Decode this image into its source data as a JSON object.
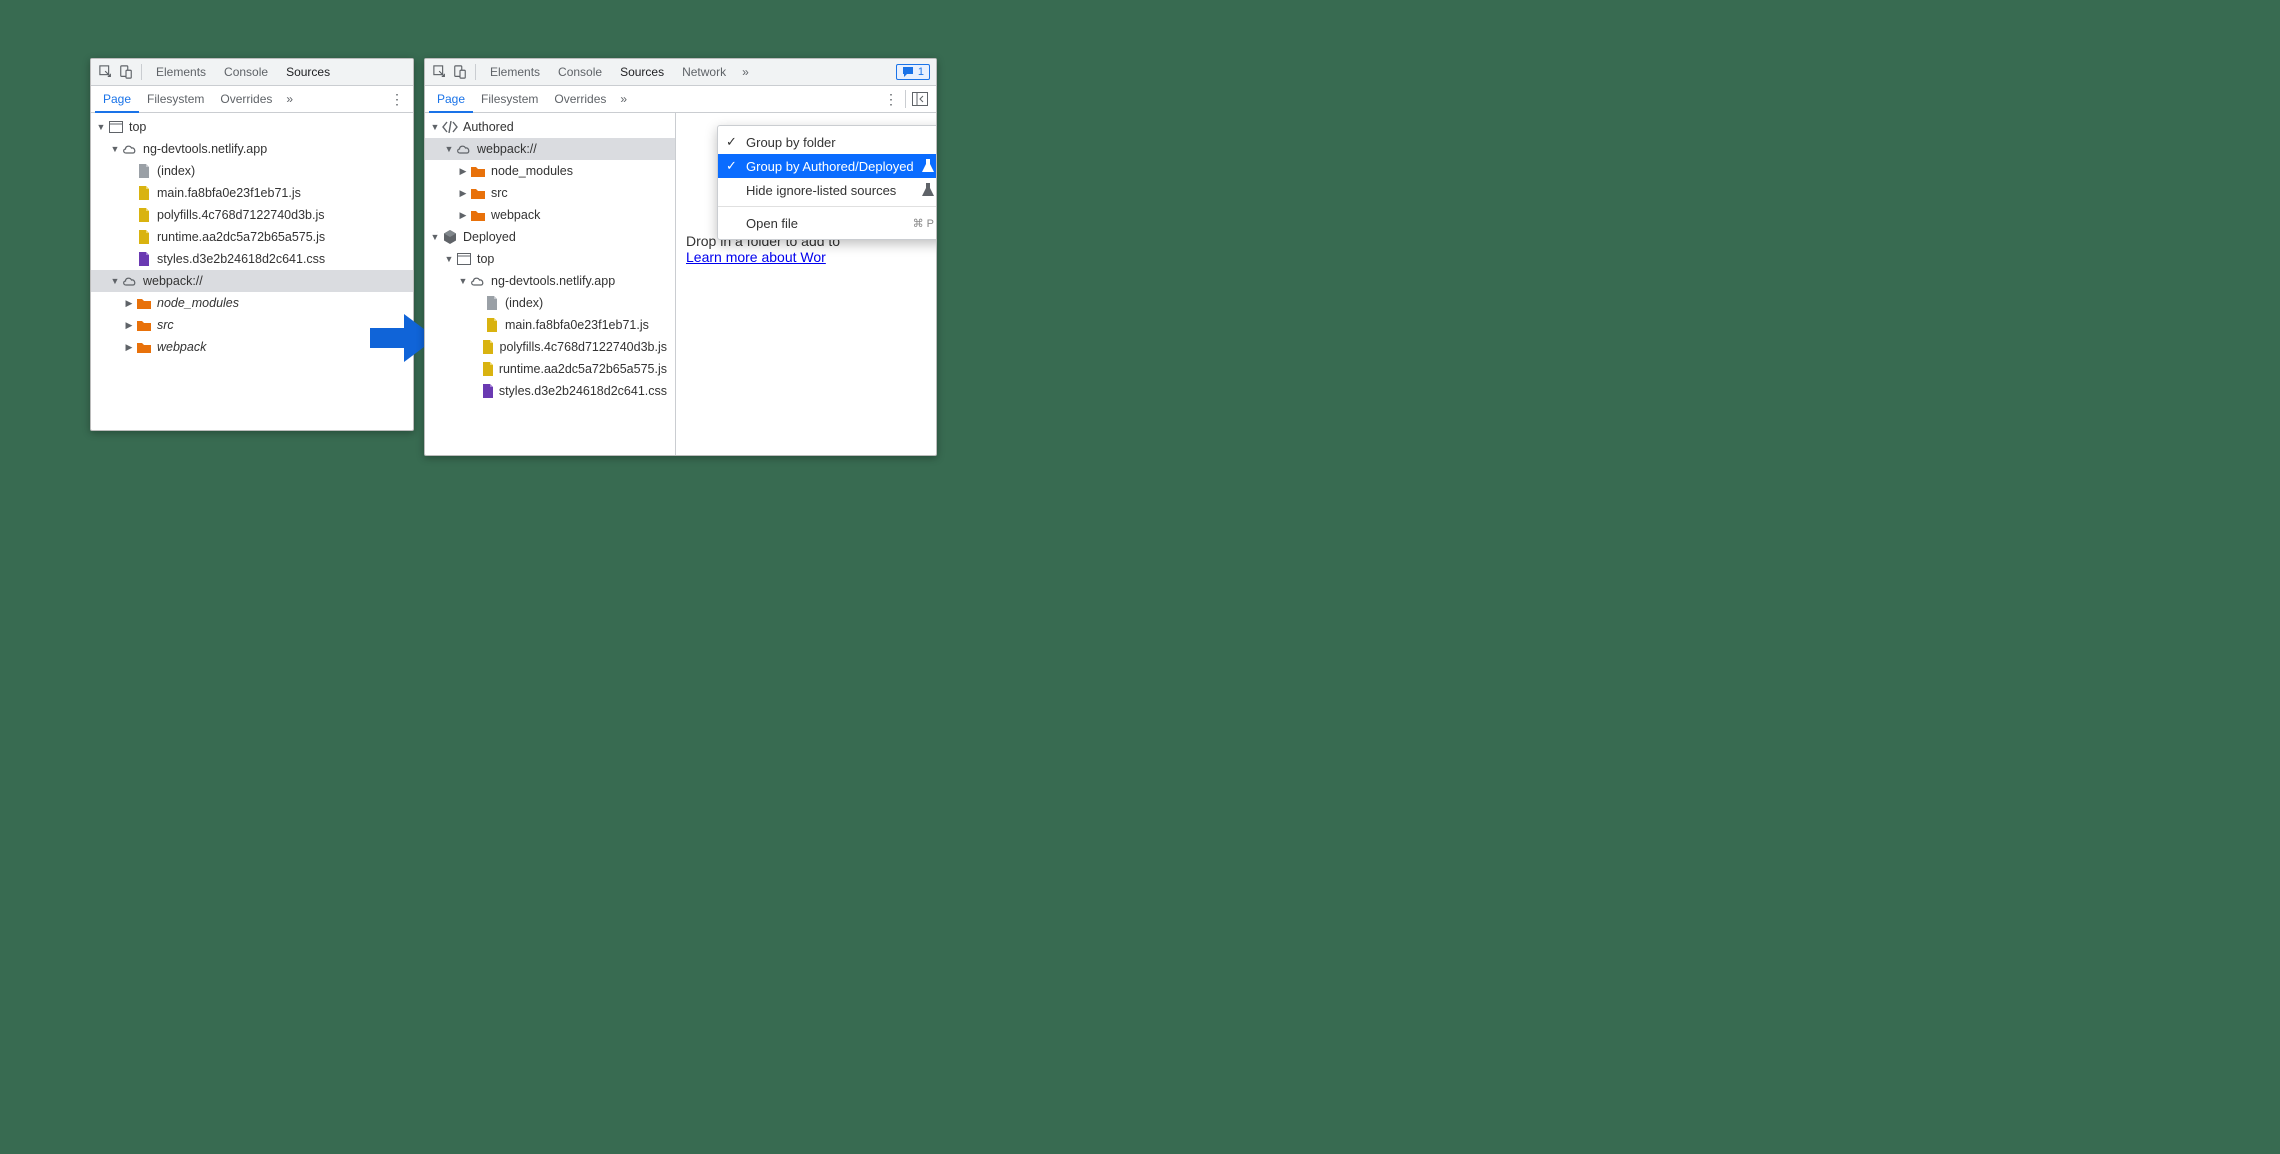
{
  "topTabs": {
    "elements": "Elements",
    "console": "Console",
    "sources": "Sources",
    "network": "Network"
  },
  "issues": {
    "count": "1"
  },
  "subTabs": {
    "page": "Page",
    "filesystem": "Filesystem",
    "overrides": "Overrides"
  },
  "leftTree": {
    "top": "top",
    "domain": "ng-devtools.netlify.app",
    "index": "(index)",
    "mainjs": "main.fa8bfa0e23f1eb71.js",
    "polyfills": "polyfills.4c768d7122740d3b.js",
    "runtime": "runtime.aa2dc5a72b65a575.js",
    "styles": "styles.d3e2b24618d2c641.css",
    "webpack": "webpack://",
    "node_modules": "node_modules",
    "src": "src",
    "wpfolder": "webpack"
  },
  "rightTree": {
    "authored": "Authored",
    "webpack": "webpack://",
    "node_modules": "node_modules",
    "src": "src",
    "wpfolder": "webpack",
    "deployed": "Deployed",
    "top": "top",
    "domain": "ng-devtools.netlify.app",
    "index": "(index)",
    "mainjs": "main.fa8bfa0e23f1eb71.js",
    "polyfills": "polyfills.4c768d7122740d3b.js",
    "runtime": "runtime.aa2dc5a72b65a575.js",
    "styles": "styles.d3e2b24618d2c641.css"
  },
  "ctxMenu": {
    "groupFolder": "Group by folder",
    "groupAuthored": "Group by Authored/Deployed",
    "hideIgnored": "Hide ignore-listed sources",
    "openFile": "Open file",
    "openShortcut": "⌘ P"
  },
  "workspace": {
    "dropMsg": "Drop in a folder to add to",
    "learnMore": "Learn more about Wor"
  }
}
